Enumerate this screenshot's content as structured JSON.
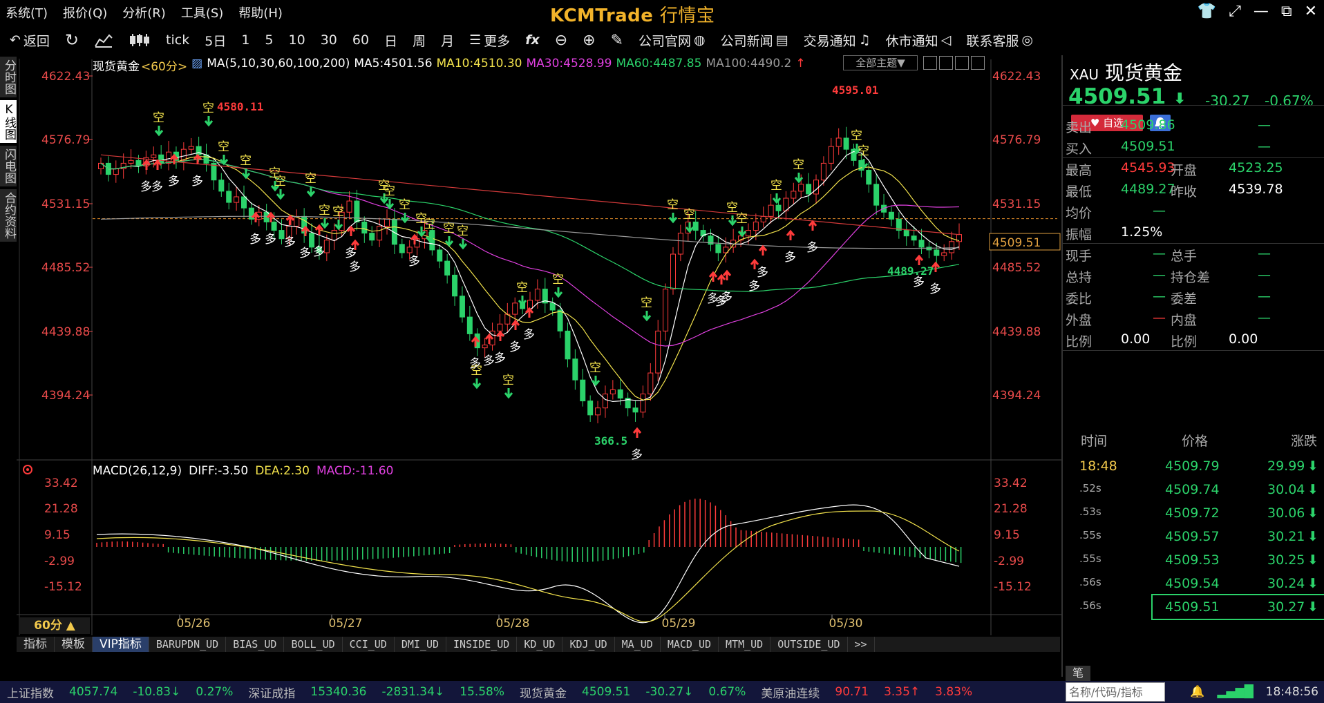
{
  "menu": [
    "系统(T)",
    "报价(Q)",
    "分析(R)",
    "工具(S)",
    "帮助(H)"
  ],
  "brand": {
    "logo": "KCMTrade",
    "sub": "行情宝"
  },
  "toolbar": {
    "back": "返回",
    "tick": "tick",
    "periods": [
      "5日",
      "1",
      "5",
      "10",
      "30",
      "60",
      "日",
      "周",
      "月"
    ],
    "more": "更多",
    "links": [
      "公司官网",
      "公司新闻",
      "交易通知",
      "休市通知",
      "联系客服"
    ]
  },
  "vtabs": [
    "分时图",
    "K线图",
    "闪电图",
    "合约资料"
  ],
  "chart": {
    "symbol": "现货黄金",
    "period_tag": "<60分>",
    "ma_params": "MA(5,10,30,60,100,200)",
    "ma5": "MA5:4501.56",
    "ma10": "MA10:4510.30",
    "ma30": "MA30:4528.99",
    "ma60": "MA60:4487.85",
    "ma100": "MA100:4490.2",
    "theme_btn": "全部主题▼",
    "y_labels": [
      "4622.43",
      "4576.79",
      "4531.15",
      "4485.52",
      "4439.88",
      "4394.24"
    ],
    "high_label": "4595.01",
    "low_label": "366.5",
    "left_high_label": "4580.11",
    "right_low_label": "4489.27",
    "price_tag": "4509.51",
    "buy_mark": "多",
    "sell_mark": "空",
    "macd_title": "MACD(26,12,9)",
    "diff": "DIFF:-3.50",
    "dea": "DEA:2.30",
    "macd": "MACD:-11.60",
    "macd_y_labels": [
      "33.42",
      "21.28",
      "9.15",
      "-2.99",
      "-15.12"
    ],
    "x_labels": [
      "05/26",
      "05/27",
      "05/28",
      "05/29",
      "05/30"
    ],
    "period_btn": "60分 ▲"
  },
  "indicator_tabs": [
    "指标",
    "模板",
    "VIP指标",
    "BARUPDN_UD",
    "BIAS_UD",
    "BOLL_UD",
    "CCI_UD",
    "DMI_UD",
    "INSIDE_UD",
    "KD_UD",
    "KDJ_UD",
    "MA_UD",
    "MACD_UD",
    "MTM_UD",
    "OUTSIDE_UD",
    ">>"
  ],
  "quote": {
    "code": "XAU",
    "name": "现货黄金",
    "price": "4509.51",
    "change": "-30.27",
    "change_pct": "-0.67%",
    "fav_label": "自选",
    "rows": [
      {
        "l1": "卖出",
        "v1": "4509.86",
        "l2": "",
        "v2": "—"
      },
      {
        "l1": "买入",
        "v1": "4509.51",
        "l2": "",
        "v2": "—"
      },
      {
        "l1": "最高",
        "v1": "4545.93",
        "l2": "开盘",
        "v2": "4523.25"
      },
      {
        "l1": "最低",
        "v1": "4489.27",
        "l2": "昨收",
        "v2": "4539.78"
      },
      {
        "l1": "均价",
        "v1": "—",
        "l2": "",
        "v2": ""
      },
      {
        "l1": "振幅",
        "v1": "1.25%",
        "l2": "",
        "v2": ""
      },
      {
        "l1": "现手",
        "v1": "—",
        "l2": "总手",
        "v2": "—"
      },
      {
        "l1": "总持",
        "v1": "—",
        "l2": "持仓差",
        "v2": "—"
      },
      {
        "l1": "委比",
        "v1": "—",
        "l2": "委差",
        "v2": "—"
      },
      {
        "l1": "外盘",
        "v1": "—",
        "l2": "内盘",
        "v2": "—"
      },
      {
        "l1": "比例",
        "v1": "0.00",
        "l2": "比例",
        "v2": "0.00"
      }
    ],
    "ticks_header": [
      "时间",
      "价格",
      "涨跌"
    ],
    "ticks": [
      {
        "t": "18:48",
        "p": "4509.79",
        "c": "29.99"
      },
      {
        "t": ".52s",
        "p": "4509.74",
        "c": "30.04"
      },
      {
        "t": ".53s",
        "p": "4509.72",
        "c": "30.06"
      },
      {
        "t": ".55s",
        "p": "4509.57",
        "c": "30.21"
      },
      {
        "t": ".55s",
        "p": "4509.53",
        "c": "30.25"
      },
      {
        "t": ".56s",
        "p": "4509.54",
        "c": "30.24"
      },
      {
        "t": ".56s",
        "p": "4509.51",
        "c": "30.27"
      }
    ],
    "bi_tab": "笔"
  },
  "status": {
    "items": [
      {
        "name": "上证指数",
        "v": "4057.74",
        "c": "-10.83↓",
        "p": "0.27%"
      },
      {
        "name": "深证成指",
        "v": "15340.36",
        "c": "-2831.34↓",
        "p": "15.58%"
      },
      {
        "name": "现货黄金",
        "v": "4509.51",
        "c": "-30.27↓",
        "p": "0.67%"
      },
      {
        "name": "美原油连续",
        "v": "90.71",
        "c": "3.35↑",
        "p": "3.83%"
      }
    ],
    "search_placeholder": "名称/代码/指标",
    "time": "18:48:56"
  },
  "colors": {
    "up": "#ff3b3b",
    "down": "#2bd26a",
    "accent": "#f2b32a"
  }
}
